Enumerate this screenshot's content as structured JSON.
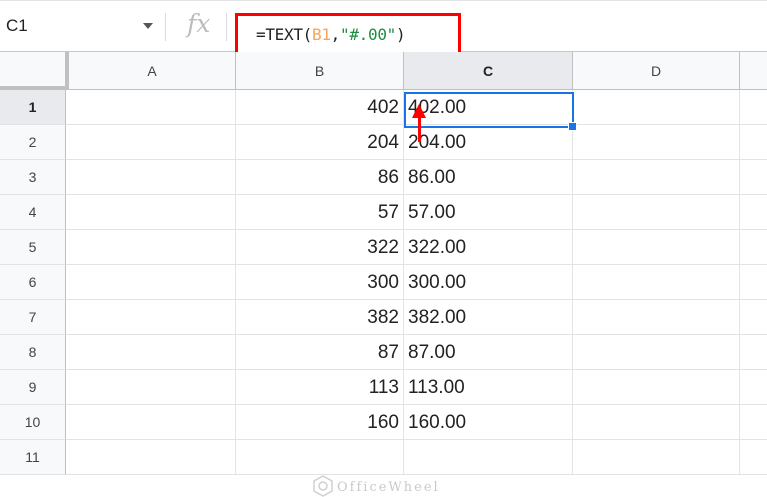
{
  "formula_bar": {
    "cell_ref": "C1",
    "fx_label": "fx",
    "formula_prefix": "=TEXT(",
    "formula_ref": "B1",
    "formula_sep": ",",
    "formula_str": "\"#.00\"",
    "formula_close": ")"
  },
  "columns": [
    "A",
    "B",
    "C",
    "D"
  ],
  "rows": [
    {
      "num": "1",
      "b": "402",
      "c": "402.00"
    },
    {
      "num": "2",
      "b": "204",
      "c": "204.00"
    },
    {
      "num": "3",
      "b": "86",
      "c": "86.00"
    },
    {
      "num": "4",
      "b": "57",
      "c": "57.00"
    },
    {
      "num": "5",
      "b": "322",
      "c": "322.00"
    },
    {
      "num": "6",
      "b": "300",
      "c": "300.00"
    },
    {
      "num": "7",
      "b": "382",
      "c": "382.00"
    },
    {
      "num": "8",
      "b": "87",
      "c": "87.00"
    },
    {
      "num": "9",
      "b": "113",
      "c": "113.00"
    },
    {
      "num": "10",
      "b": "160",
      "c": "160.00"
    },
    {
      "num": "11",
      "b": "",
      "c": ""
    }
  ],
  "selected_cell": "C1",
  "annotation_color": "#ff0000",
  "selection_color": "#1a73e8",
  "watermark": "OfficeWheel"
}
